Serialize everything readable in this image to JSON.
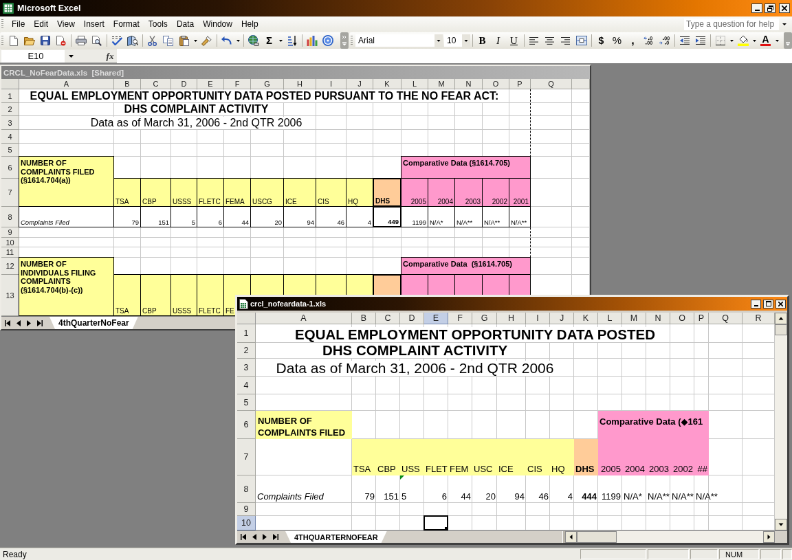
{
  "app": {
    "title": "Microsoft Excel"
  },
  "menu": [
    "File",
    "Edit",
    "View",
    "Insert",
    "Format",
    "Tools",
    "Data",
    "Window",
    "Help"
  ],
  "help_box": {
    "placeholder": "Type a question for help"
  },
  "toolbar": {
    "font": "Arial",
    "font_size": "10",
    "style_buttons": [
      {
        "label": "B",
        "kind": "bold"
      },
      {
        "label": "I",
        "kind": "italic"
      },
      {
        "label": "U",
        "kind": "underline"
      }
    ],
    "number_buttons": [
      {
        "label": "$",
        "kind": "currency"
      },
      {
        "label": "%",
        "kind": "percent"
      },
      {
        "label": ",",
        "kind": "comma"
      }
    ],
    "autosum": "Σ",
    "font_color": "A"
  },
  "formula_bar": {
    "name_box": "E10",
    "function_button": "fx"
  },
  "windows": [
    {
      "title": "CRCL_NoFearData.xls  [Shared]",
      "active": false,
      "kind": "formatted",
      "columns": [
        {
          "label": "A",
          "selected": false
        },
        {
          "label": "B",
          "selected": false
        },
        {
          "label": "C",
          "selected": false
        },
        {
          "label": "D",
          "selected": false
        },
        {
          "label": "E",
          "selected": false
        },
        {
          "label": "F",
          "selected": false
        },
        {
          "label": "G",
          "selected": false
        },
        {
          "label": "H",
          "selected": false
        },
        {
          "label": "I",
          "selected": false
        },
        {
          "label": "J",
          "selected": false
        },
        {
          "label": "K",
          "selected": false
        },
        {
          "label": "L",
          "selected": false
        },
        {
          "label": "M",
          "selected": false
        },
        {
          "label": "N",
          "selected": false
        },
        {
          "label": "O",
          "selected": false
        },
        {
          "label": "P",
          "selected": false
        },
        {
          "label": "Q",
          "selected": false
        }
      ],
      "rows": [
        {
          "label": "1",
          "selected": false
        },
        {
          "label": "2",
          "selected": false
        },
        {
          "label": "3",
          "selected": false
        },
        {
          "label": "4",
          "selected": false
        },
        {
          "label": "5",
          "selected": false
        },
        {
          "label": "6",
          "selected": false
        },
        {
          "label": "7",
          "selected": false
        },
        {
          "label": "8",
          "selected": false
        },
        {
          "label": "9",
          "selected": false
        },
        {
          "label": "10",
          "selected": false
        },
        {
          "label": "11",
          "selected": false
        },
        {
          "label": "12",
          "selected": false
        },
        {
          "label": "13",
          "selected": false
        }
      ],
      "sheet": {
        "title": "EQUAL EMPLOYMENT OPPORTUNITY DATA POSTED PURSUANT TO THE NO FEAR ACT:",
        "subtitle": "DHS COMPLAINT ACTIVITY",
        "date": "Data as of March 31, 2006 - 2nd QTR 2006",
        "sections": [
          {
            "heading": "NUMBER OF COMPLAINTS FILED (§1614.704(a))",
            "comparative_heading": "Comparative Data (§1614.705)",
            "agencies": [
              "TSA",
              "CBP",
              "USSS",
              "FLETC",
              "FEMA",
              "USCG",
              "ICE",
              "CIS",
              "HQ"
            ],
            "total_label": "DHS",
            "years": [
              "2005",
              "2004",
              "2003",
              "2002",
              "2001"
            ],
            "data_row": {
              "label": "Complaints Filed",
              "values": [
                {
                  "text": "79",
                  "kind": "number",
                  "flagged": false
                },
                {
                  "text": "151",
                  "kind": "number",
                  "flagged": false
                },
                {
                  "text": "5",
                  "kind": "number",
                  "flagged": false
                },
                {
                  "text": "6",
                  "kind": "number",
                  "flagged": false
                },
                {
                  "text": "44",
                  "kind": "number",
                  "flagged": false
                },
                {
                  "text": "20",
                  "kind": "number",
                  "flagged": false
                },
                {
                  "text": "94",
                  "kind": "number",
                  "flagged": false
                },
                {
                  "text": "46",
                  "kind": "number",
                  "flagged": false
                },
                {
                  "text": "4",
                  "kind": "number",
                  "flagged": false
                }
              ],
              "total": "449",
              "comparisons": [
                {
                  "text": "1199",
                  "kind": "number"
                },
                {
                  "text": "N/A*",
                  "kind": "text"
                },
                {
                  "text": "N/A**",
                  "kind": "text"
                },
                {
                  "text": "N/A**",
                  "kind": "text"
                },
                {
                  "text": "N/A**",
                  "kind": "text"
                }
              ]
            }
          },
          {
            "heading": "NUMBER OF INDIVIDUALS FILING COMPLAINTS (§1614.704(b)-(c))",
            "comparative_heading": "Comparative Data  (§1614.705)",
            "agencies": [
              "TSA",
              "CBP",
              "USSS",
              "FLETC",
              "FE"
            ]
          }
        ]
      },
      "sheet_tabs": [
        {
          "label": "4thQuarterNoFear",
          "selected": true
        }
      ]
    },
    {
      "title": "crcl_nofeardata-1.xls",
      "active": true,
      "kind": "plain",
      "columns": [
        {
          "label": "A",
          "selected": false
        },
        {
          "label": "B",
          "selected": false
        },
        {
          "label": "C",
          "selected": false
        },
        {
          "label": "D",
          "selected": false
        },
        {
          "label": "E",
          "selected": true
        },
        {
          "label": "F",
          "selected": false
        },
        {
          "label": "G",
          "selected": false
        },
        {
          "label": "H",
          "selected": false
        },
        {
          "label": "I",
          "selected": false
        },
        {
          "label": "J",
          "selected": false
        },
        {
          "label": "K",
          "selected": false
        },
        {
          "label": "L",
          "selected": false
        },
        {
          "label": "M",
          "selected": false
        },
        {
          "label": "N",
          "selected": false
        },
        {
          "label": "O",
          "selected": false
        },
        {
          "label": "P",
          "selected": false
        },
        {
          "label": "Q",
          "selected": false
        },
        {
          "label": "R",
          "selected": false
        }
      ],
      "rows": [
        {
          "label": "1",
          "selected": false
        },
        {
          "label": "2",
          "selected": false
        },
        {
          "label": "3",
          "selected": false
        },
        {
          "label": "4",
          "selected": false
        },
        {
          "label": "5",
          "selected": false
        },
        {
          "label": "6",
          "selected": false
        },
        {
          "label": "7",
          "selected": false
        },
        {
          "label": "8",
          "selected": false
        },
        {
          "label": "9",
          "selected": false
        },
        {
          "label": "10",
          "selected": true
        }
      ],
      "sheet": {
        "title": "EQUAL EMPLOYMENT OPPORTUNITY DATA POSTED",
        "subtitle": "DHS COMPLAINT ACTIVITY",
        "date": "Data as of March 31, 2006 - 2nd QTR 2006",
        "sections": [
          {
            "heading": "NUMBER OF COMPLAINTS FILED",
            "comparative_heading": "Comparative Data (◆161",
            "agencies": [
              "TSA",
              "CBP",
              "USS",
              "FLET",
              "FEM",
              "USC",
              "ICE",
              "CIS",
              "HQ"
            ],
            "total_label": "DHS",
            "years": [
              "2005",
              "2004",
              "2003",
              "2002",
              "##"
            ],
            "data_row": {
              "label": "Complaints Filed",
              "values": [
                {
                  "text": "79",
                  "kind": "number",
                  "flagged": false
                },
                {
                  "text": "151",
                  "kind": "number",
                  "flagged": false
                },
                {
                  "text": "5",
                  "kind": "text",
                  "flagged": true
                },
                {
                  "text": "6",
                  "kind": "number",
                  "flagged": false
                },
                {
                  "text": "44",
                  "kind": "number",
                  "flagged": false
                },
                {
                  "text": "20",
                  "kind": "number",
                  "flagged": false
                },
                {
                  "text": "94",
                  "kind": "number",
                  "flagged": false
                },
                {
                  "text": "46",
                  "kind": "number",
                  "flagged": false
                },
                {
                  "text": "4",
                  "kind": "number",
                  "flagged": false
                }
              ],
              "total": "444",
              "comparisons": [
                {
                  "text": "1199",
                  "kind": "number"
                },
                {
                  "text": "N/A*",
                  "kind": "text"
                },
                {
                  "text": "N/A**",
                  "kind": "text"
                },
                {
                  "text": "N/A**",
                  "kind": "text"
                },
                {
                  "text": "N/A**",
                  "kind": "text"
                }
              ]
            }
          }
        ]
      },
      "sheet_tabs": [
        {
          "label": "4THQUARTERNOFEAR",
          "selected": true
        }
      ]
    }
  ],
  "status_bar": {
    "text": "Ready",
    "indicator": "NUM"
  }
}
